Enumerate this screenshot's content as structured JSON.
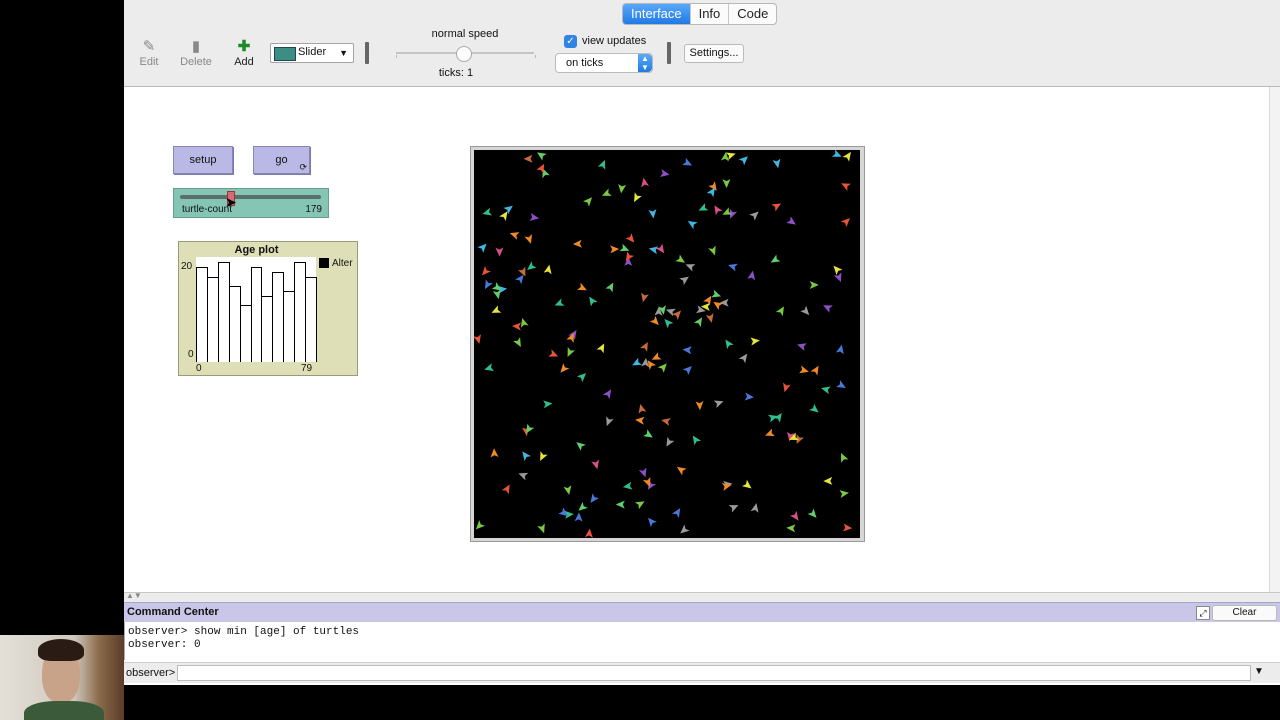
{
  "tabs": [
    {
      "label": "Interface"
    },
    {
      "label": "Info"
    },
    {
      "label": "Code"
    }
  ],
  "toolbar": {
    "edit": "Edit",
    "delete": "Delete",
    "add": "Add",
    "widget_type": "Slider",
    "speed_label": "normal speed",
    "ticks": "ticks: 1",
    "view_updates_label": "view updates",
    "view_updates_checked": true,
    "update_mode": "on ticks",
    "settings": "Settings..."
  },
  "buttons": {
    "setup": "setup",
    "go": "go"
  },
  "slider": {
    "name": "turtle-count",
    "value": "179"
  },
  "plot": {
    "title": "Age plot",
    "y_max": "20",
    "y_min": "0",
    "x_min": "0",
    "x_max": "79",
    "legend": "Alter"
  },
  "chart_data": {
    "type": "bar",
    "title": "Age plot",
    "xlabel": "",
    "ylabel": "",
    "xlim": [
      0,
      79
    ],
    "ylim": [
      0,
      20
    ],
    "series": [
      {
        "name": "Alter",
        "values": [
          20,
          18,
          21,
          16,
          12,
          20,
          14,
          19,
          15,
          21,
          18
        ]
      }
    ],
    "legend": "top-right"
  },
  "command_center": {
    "title": "Command Center",
    "clear": "Clear",
    "output_line1": "observer> show min [age] of turtles",
    "output_line2": "observer: 0",
    "prompt": "observer>"
  },
  "colors": {
    "button_bg": "#bab9e6",
    "slider_bg": "#85c5b4",
    "plot_bg": "#dfdfb7",
    "world_bg": "#000000",
    "accent": "#1f7ae6"
  }
}
